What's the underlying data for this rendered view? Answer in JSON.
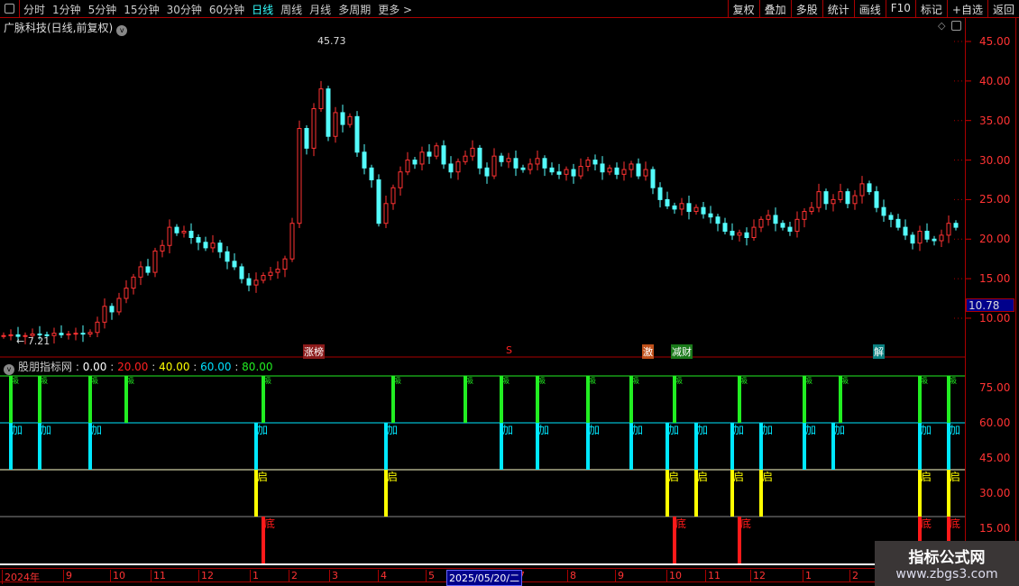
{
  "toolbar": {
    "periods": [
      "分时",
      "1分钟",
      "5分钟",
      "15分钟",
      "30分钟",
      "60分钟",
      "日线",
      "周线",
      "月线",
      "多周期",
      "更多 >"
    ],
    "active_period": "日线",
    "buttons": [
      "复权",
      "叠加",
      "多股",
      "统计",
      "画线",
      "F10",
      "标记",
      "+自选",
      "返回"
    ]
  },
  "stock_title": "广脉科技(日线,前复权)",
  "price_axis": {
    "labels": [
      "45.00",
      "40.00",
      "35.00",
      "30.00",
      "25.00",
      "20.00",
      "15.00",
      "10.00"
    ],
    "current_price": "10.78"
  },
  "chart_data": {
    "type": "candlestick",
    "ylim": [
      7,
      47
    ],
    "max_label": "45.73",
    "min_label": "← 7.21",
    "closes": [
      7.8,
      7.9,
      7.7,
      7.8,
      8.0,
      7.9,
      7.8,
      8.1,
      7.9,
      8.0,
      8.1,
      8.0,
      8.2,
      9.5,
      11.5,
      10.8,
      12.5,
      13.8,
      15.2,
      16.5,
      15.8,
      18.5,
      19.2,
      21.5,
      20.8,
      21.0,
      20.2,
      19.6,
      18.9,
      19.5,
      18.4,
      17.2,
      16.5,
      15.0,
      14.2,
      14.8,
      15.4,
      15.8,
      16.2,
      17.5,
      22.0,
      34.0,
      31.5,
      36.5,
      39.0,
      33.0,
      36.0,
      34.5,
      35.5,
      31.0,
      29.0,
      27.5,
      22.0,
      24.5,
      26.5,
      28.5,
      30.0,
      29.5,
      31.0,
      30.5,
      31.8,
      29.5,
      28.5,
      29.8,
      30.5,
      31.5,
      29.0,
      28.0,
      30.5,
      29.8,
      30.2,
      29.0,
      28.8,
      29.5,
      30.2,
      29.0,
      28.5,
      28.2,
      28.8,
      28.0,
      29.2,
      30.0,
      29.5,
      28.5,
      29.0,
      28.2,
      28.8,
      29.5,
      28.0,
      28.8,
      26.5,
      25.0,
      24.2,
      23.8,
      24.5,
      23.5,
      24.0,
      23.2,
      22.8,
      22.0,
      21.0,
      20.5,
      20.8,
      20.2,
      21.5,
      22.5,
      23.0,
      22.0,
      21.5,
      21.0,
      22.5,
      23.5,
      24.0,
      26.0,
      24.5,
      25.0,
      26.0,
      24.5,
      25.5,
      27.0,
      26.0,
      24.0,
      23.0,
      22.5,
      21.5,
      20.5,
      19.5,
      21.0,
      20.0,
      19.8,
      20.5,
      22.0,
      21.5
    ],
    "up_color": "#ff3232",
    "down_color": "#54fcfc"
  },
  "event_tags": [
    {
      "text": "涨榜",
      "bar": 42,
      "color": "#8b1a1a"
    },
    {
      "text": "S",
      "bar": 70,
      "color": "transparent"
    },
    {
      "text": "激",
      "bar": 89,
      "color": "#c0501a"
    },
    {
      "text": "减财",
      "bar": 93,
      "color": "#1a7a1a"
    },
    {
      "text": "解",
      "bar": 121,
      "color": "#0a8080"
    }
  ],
  "indicator": {
    "name": "股朋指标网",
    "values": [
      {
        "text": "0.00",
        "color": "#ffffff"
      },
      {
        "text": "20.00",
        "color": "#ff2020"
      },
      {
        "text": "40.00",
        "color": "#ffff00"
      },
      {
        "text": "60.00",
        "color": "#00e0ff"
      },
      {
        "text": "80.00",
        "color": "#22ee22"
      }
    ],
    "axis_labels": [
      "75.00",
      "60.00",
      "45.00",
      "30.00",
      "15.00"
    ],
    "signals": [
      {
        "label": "吸",
        "color": "#22ee22",
        "from": 80,
        "to": 60,
        "bars": [
          1,
          5,
          12,
          17,
          36,
          54,
          64,
          69,
          74,
          81,
          87,
          93,
          102,
          111,
          116,
          127,
          131
        ]
      },
      {
        "label": "加",
        "color": "#00e8ff",
        "from": 60,
        "to": 40,
        "bars": [
          1,
          5,
          12,
          35,
          53,
          69,
          74,
          81,
          87,
          92,
          96,
          101,
          105,
          111,
          115,
          127,
          131
        ]
      },
      {
        "label": "启",
        "color": "#ffff00",
        "from": 40,
        "to": 20,
        "bars": [
          35,
          53,
          92,
          96,
          101,
          105,
          127,
          131
        ]
      },
      {
        "label": "底",
        "color": "#ff1a1a",
        "from": 20,
        "to": 0,
        "bars": [
          36,
          93,
          102,
          127,
          131
        ]
      }
    ]
  },
  "time_axis": {
    "labels": [
      "2024年",
      "9",
      "10",
      "11",
      "12",
      "1",
      "2",
      "3",
      "4",
      "5",
      "7",
      "8",
      "9",
      "10",
      "11",
      "12",
      "1",
      "2"
    ],
    "selected_date": "2025/05/20/二"
  },
  "watermark": {
    "line1": "指标公式网",
    "line2": "www.zbgs3.com"
  }
}
